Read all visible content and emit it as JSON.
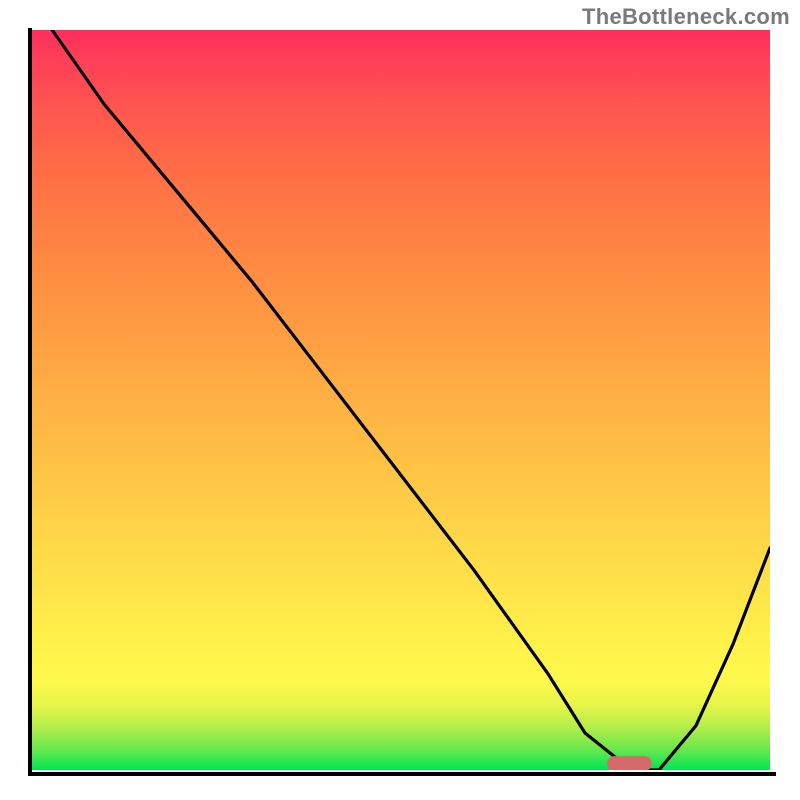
{
  "watermark": "TheBottleneck.com",
  "chart_data": {
    "type": "line",
    "title": "",
    "xlabel": "",
    "ylabel": "",
    "xlim": [
      0,
      100
    ],
    "ylim": [
      0,
      100
    ],
    "grid": false,
    "legend": false,
    "annotations": [],
    "series": [
      {
        "name": "bottleneck-curve",
        "color": "#000000",
        "x": [
          3,
          10,
          20,
          25,
          30,
          40,
          50,
          60,
          70,
          75,
          80,
          82,
          85,
          90,
          95,
          100
        ],
        "y": [
          100,
          90,
          78,
          72,
          66,
          53,
          40,
          27,
          13,
          5,
          1,
          0,
          0,
          6,
          17,
          30
        ]
      }
    ],
    "marker": {
      "name": "optimum-marker",
      "color": "#d46a6a",
      "x_range": [
        78,
        84
      ],
      "y": 0.8
    },
    "background": {
      "type": "vertical-gradient",
      "stops": [
        {
          "pos": 0.0,
          "color": "#00e553"
        },
        {
          "pos": 0.1,
          "color": "#fef94c"
        },
        {
          "pos": 0.5,
          "color": "#ffb544"
        },
        {
          "pos": 1.0,
          "color": "#ff2e5f"
        }
      ]
    }
  }
}
